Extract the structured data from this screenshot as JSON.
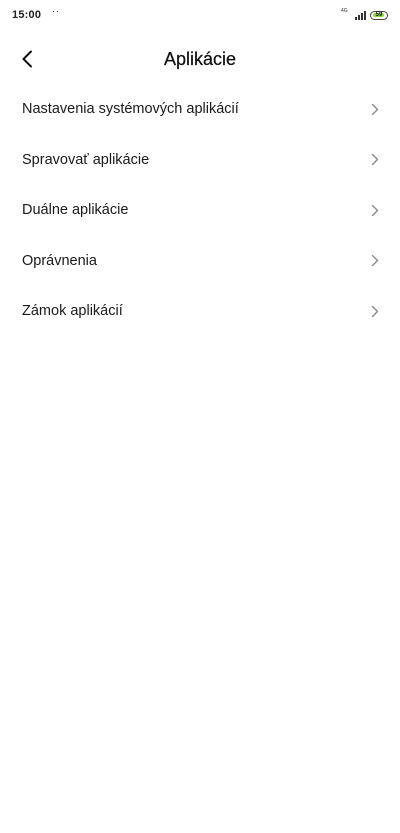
{
  "status_bar": {
    "time": "15:00",
    "notification_dots": "··",
    "network_label": "4G",
    "sim_label": "ᵢₗ",
    "battery_level": "59",
    "battery_color": "#8bd63a"
  },
  "header": {
    "title": "Aplikácie",
    "back_icon": "chevron-left-icon"
  },
  "list": {
    "items": [
      {
        "label": "Nastavenia systémových aplikácií",
        "icon": "chevron-right-icon"
      },
      {
        "label": "Spravovať aplikácie",
        "icon": "chevron-right-icon"
      },
      {
        "label": "Duálne aplikácie",
        "icon": "chevron-right-icon"
      },
      {
        "label": "Oprávnenia",
        "icon": "chevron-right-icon"
      },
      {
        "label": "Zámok aplikácií",
        "icon": "chevron-right-icon"
      }
    ]
  }
}
